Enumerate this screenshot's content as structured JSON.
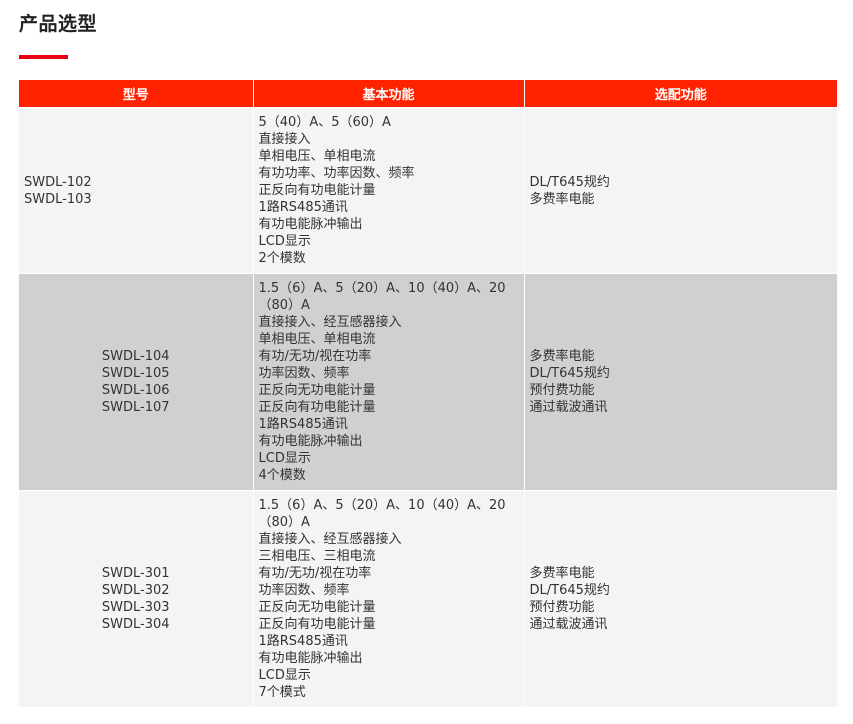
{
  "page": {
    "title": "产品选型",
    "accent_color": "#e60012"
  },
  "table": {
    "header_color": "#ff2200",
    "headers": [
      "型号",
      "基本功能",
      "选配功能"
    ],
    "rows": [
      {
        "models": [
          "SWDL-102",
          "SWDL-103"
        ],
        "basic": [
          "5（40）A、5（60）A",
          "直接接入",
          "单相电压、单相电流",
          "有功功率、功率因数、频率",
          "正反向有功电能计量",
          "1路RS485通讯",
          "有功电能脉冲输出",
          "LCD显示",
          "2个模数"
        ],
        "optional": [
          "DL/T645规约",
          "多费率电能"
        ]
      },
      {
        "models": [
          "SWDL-104",
          "SWDL-105",
          "SWDL-106",
          "SWDL-107"
        ],
        "basic": [
          "1.5（6）A、5（20）A、10（40）A、20（80）A",
          "直接接入、经互感器接入",
          "单相电压、单相电流",
          "有功/无功/视在功率",
          "功率因数、频率",
          "正反向无功电能计量",
          "正反向有功电能计量",
          "1路RS485通讯",
          "有功电能脉冲输出",
          "LCD显示",
          "4个模数"
        ],
        "optional": [
          "多费率电能",
          "DL/T645规约",
          "预付费功能",
          "通过载波通讯"
        ]
      },
      {
        "models": [
          "SWDL-301",
          "SWDL-302",
          "SWDL-303",
          "SWDL-304"
        ],
        "basic": [
          "1.5（6）A、5（20）A、10（40）A、20（80）A",
          "直接接入、经互感器接入",
          "三相电压、三相电流",
          "有功/无功/视在功率",
          "功率因数、频率",
          "正反向无功电能计量",
          "正反向有功电能计量",
          "1路RS485通讯",
          "有功电能脉冲输出",
          "LCD显示",
          "7个模式"
        ],
        "optional": [
          "多费率电能",
          "DL/T645规约",
          "预付费功能",
          "通过载波通讯"
        ]
      }
    ]
  }
}
